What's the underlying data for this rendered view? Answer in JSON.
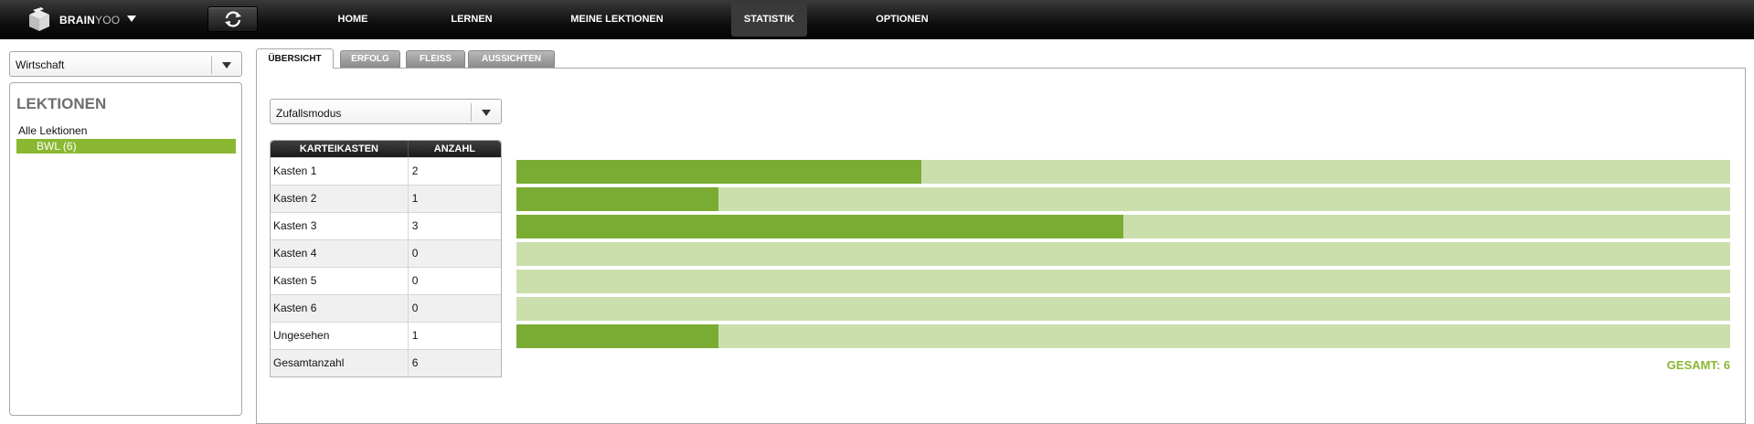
{
  "brand": {
    "name_bold": "BRAIN",
    "name_light": "YOO"
  },
  "nav": [
    {
      "label": "HOME"
    },
    {
      "label": "LERNEN"
    },
    {
      "label": "MEINE LEKTIONEN"
    },
    {
      "label": "STATISTIK",
      "active": true
    },
    {
      "label": "OPTIONEN"
    }
  ],
  "sidebar": {
    "subject_select": "Wirtschaft",
    "lessons_title": "LEKTIONEN",
    "all_lessons": "Alle Lektionen",
    "selected_lesson": "BWL (6)"
  },
  "tabs": [
    {
      "label": "ÜBERSICHT",
      "active": true
    },
    {
      "label": "ERFOLG"
    },
    {
      "label": "FLEISS"
    },
    {
      "label": "AUSSICHTEN"
    }
  ],
  "mode_select": "Zufallsmodus",
  "table": {
    "headers": [
      "KARTEIKASTEN",
      "ANZAHL"
    ],
    "rows": [
      {
        "name": "Kasten 1",
        "count": "2"
      },
      {
        "name": "Kasten 2",
        "count": "1"
      },
      {
        "name": "Kasten 3",
        "count": "3"
      },
      {
        "name": "Kasten 4",
        "count": "0"
      },
      {
        "name": "Kasten 5",
        "count": "0"
      },
      {
        "name": "Kasten 6",
        "count": "0"
      },
      {
        "name": "Ungesehen",
        "count": "1"
      },
      {
        "name": "Gesamtanzahl",
        "count": "6"
      }
    ]
  },
  "chart_data": {
    "type": "bar",
    "categories": [
      "Kasten 1",
      "Kasten 2",
      "Kasten 3",
      "Kasten 4",
      "Kasten 5",
      "Kasten 6",
      "Ungesehen"
    ],
    "values": [
      2,
      1,
      3,
      0,
      0,
      0,
      1
    ],
    "ylim": [
      0,
      6
    ],
    "fill_color": "#7aab32",
    "track_color": "#cbdfad"
  },
  "total_label": "GESAMT: 6",
  "colors": {
    "accent": "#8ab832"
  }
}
